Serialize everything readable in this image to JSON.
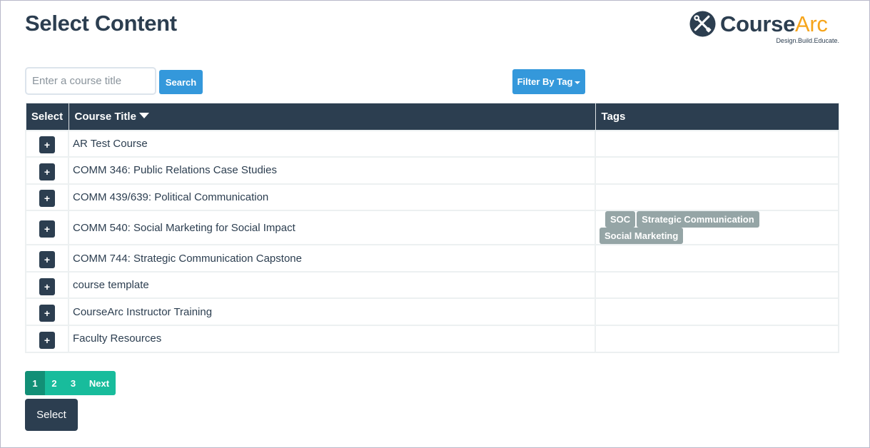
{
  "page": {
    "title": "Select Content"
  },
  "logo": {
    "course": "Course",
    "arc": "Arc",
    "tagline": "Design.Build.Educate."
  },
  "search": {
    "placeholder": "Enter a course title",
    "value": "",
    "button_label": "Search"
  },
  "filter": {
    "label": "Filter By Tag"
  },
  "table": {
    "headers": {
      "select": "Select",
      "title": "Course Title",
      "tags": "Tags"
    },
    "add_label": "+",
    "rows": [
      {
        "title": "AR Test Course",
        "tags": []
      },
      {
        "title": "COMM 346: Public Relations Case Studies",
        "tags": []
      },
      {
        "title": "COMM 439/639: Political Communication",
        "tags": []
      },
      {
        "title": "COMM 540: Social Marketing for Social Impact",
        "tags": [
          "SOC",
          "Strategic Communication",
          "Social Marketing"
        ]
      },
      {
        "title": "COMM 744: Strategic Communication Capstone",
        "tags": []
      },
      {
        "title": "course template",
        "tags": []
      },
      {
        "title": "CourseArc Instructor Training",
        "tags": []
      },
      {
        "title": "Faculty Resources",
        "tags": []
      }
    ]
  },
  "pagination": {
    "pages": [
      "1",
      "2",
      "3"
    ],
    "current": "1",
    "next": "Next"
  },
  "footer": {
    "select_button": "Select"
  },
  "colors": {
    "primary": "#2c3e50",
    "info": "#3498db",
    "success": "#18bc9c",
    "tag": "#95a5a6",
    "brand_orange": "#f6a51c"
  }
}
